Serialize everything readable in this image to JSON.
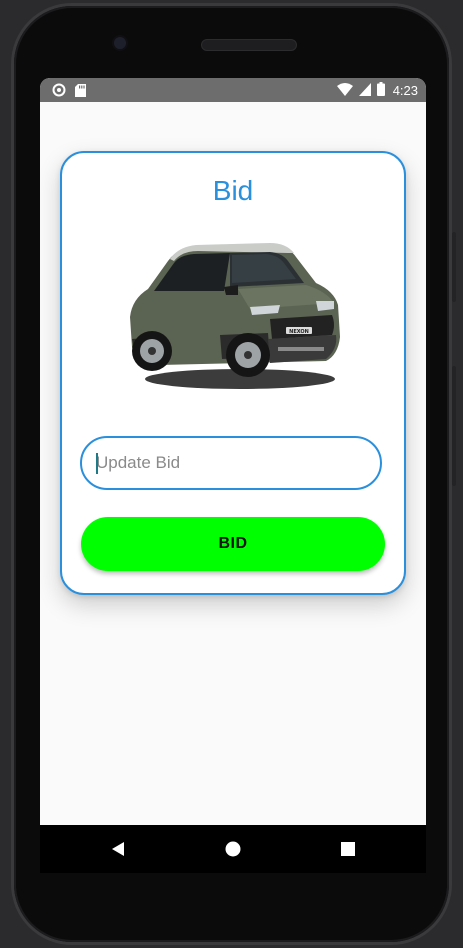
{
  "status_bar": {
    "time": "4:23",
    "left_icons": [
      "sync-circle-icon",
      "sd-card-icon"
    ],
    "right_icons": [
      "wifi-icon",
      "cellular-signal-icon",
      "battery-icon"
    ]
  },
  "card": {
    "title": "Bid",
    "car_image_label": "NEXON",
    "input": {
      "placeholder": "Update Bid",
      "value": ""
    },
    "button_label": "BID"
  },
  "colors": {
    "accent": "#2a8fdc",
    "button": "#00ff00",
    "status_bar": "#6d6d6d",
    "screen_bg": "#fafafa"
  },
  "nav_bar": {
    "buttons": [
      "back-icon",
      "home-icon",
      "recents-icon"
    ]
  }
}
